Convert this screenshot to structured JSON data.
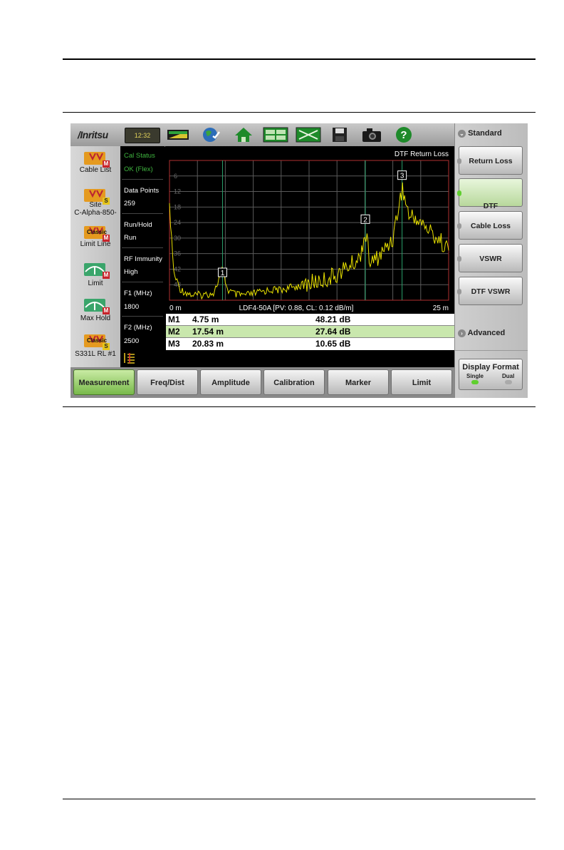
{
  "toolbar": {
    "brand": "/Inritsu",
    "clock": "12:32"
  },
  "left_panel": {
    "items": [
      {
        "label": "Cable List",
        "badge": "M"
      },
      {
        "label": "Site",
        "sublabel": "C-Alpha-850-",
        "badge": "S"
      },
      {
        "label": "Limit Line",
        "badge": "M",
        "overlay": "Classic"
      },
      {
        "label": "Limit",
        "badge": "M"
      },
      {
        "label": "Max Hold",
        "badge": "M"
      },
      {
        "label": "S331L RL #1",
        "badge": "S",
        "overlay": "Classic"
      }
    ]
  },
  "info": {
    "cal_status_label": "Cal Status",
    "cal_status_value": "OK (Flex)",
    "data_points_label": "Data Points",
    "data_points_value": "259",
    "run_hold_label": "Run/Hold",
    "run_hold_value": "Run",
    "rf_immunity_label": "RF Immunity",
    "rf_immunity_value": "High",
    "f1_label": "F1 (MHz)",
    "f1_value": "1800",
    "f2_label": "F2 (MHz)",
    "f2_value": "2500"
  },
  "chart_data": {
    "type": "line",
    "title": "DTF Return Loss",
    "x_start_label": "0 m",
    "x_end_label": "25 m",
    "x_center_label": "LDF4-50A [PV: 0.88,  CL: 0.12 dB/m]",
    "xlim": [
      0,
      25
    ],
    "ylim": [
      0,
      54
    ],
    "y_inverted": true,
    "ytick_labels": [
      "6",
      "12",
      "18",
      "24",
      "30",
      "36",
      "42",
      "48"
    ],
    "grid": true,
    "trace_color": "#e8e000",
    "series": [
      {
        "x": [
          0,
          0.4,
          1,
          2,
          3,
          4,
          4.75,
          5.2,
          6,
          7,
          8,
          9,
          10,
          11,
          12,
          13,
          14,
          15,
          16,
          17,
          17.54,
          18,
          19,
          20,
          20.83,
          21.5,
          22,
          23,
          24,
          25
        ],
        "values": [
          18,
          44,
          50,
          52,
          52,
          51,
          42,
          50,
          52,
          52,
          51,
          50,
          50,
          49,
          48,
          47,
          46,
          44,
          41,
          38,
          27.6,
          40,
          36,
          30,
          10.6,
          22,
          22,
          26,
          30,
          34
        ]
      }
    ],
    "markers": [
      {
        "label": "1",
        "x": 4.75,
        "y": 48.21
      },
      {
        "label": "2",
        "x": 17.54,
        "y": 27.64
      },
      {
        "label": "3",
        "x": 20.83,
        "y": 10.65
      }
    ]
  },
  "marker_table": [
    {
      "id": "M1",
      "pos": "4.75  m",
      "val": "48.21  dB",
      "highlight": false
    },
    {
      "id": "M2",
      "pos": "17.54  m",
      "val": "27.64  dB",
      "highlight": true
    },
    {
      "id": "M3",
      "pos": "20.83  m",
      "val": "10.65  dB",
      "highlight": false
    }
  ],
  "bottom_menu": [
    {
      "label": "Measurement",
      "active": true
    },
    {
      "label": "Freq/Dist",
      "active": false
    },
    {
      "label": "Amplitude",
      "active": false
    },
    {
      "label": "Calibration",
      "active": false
    },
    {
      "label": "Marker",
      "active": false
    },
    {
      "label": "Limit",
      "active": false
    }
  ],
  "right_panel": {
    "header": "Standard",
    "buttons": [
      {
        "label": "Return Loss",
        "active": false
      },
      {
        "label": "DTF\nReturn Loss",
        "active": true
      },
      {
        "label": "Cable Loss",
        "active": false
      },
      {
        "label": "VSWR",
        "active": false
      },
      {
        "label": "DTF VSWR",
        "active": false
      }
    ],
    "advanced": "Advanced",
    "display_format": {
      "title": "Display Format",
      "opt1": "Single",
      "opt2": "Dual"
    }
  },
  "colors": {
    "accent_green": "#78b94a",
    "trace": "#e8e000",
    "grid": "#5a5a5a",
    "frame": "#b03030"
  }
}
